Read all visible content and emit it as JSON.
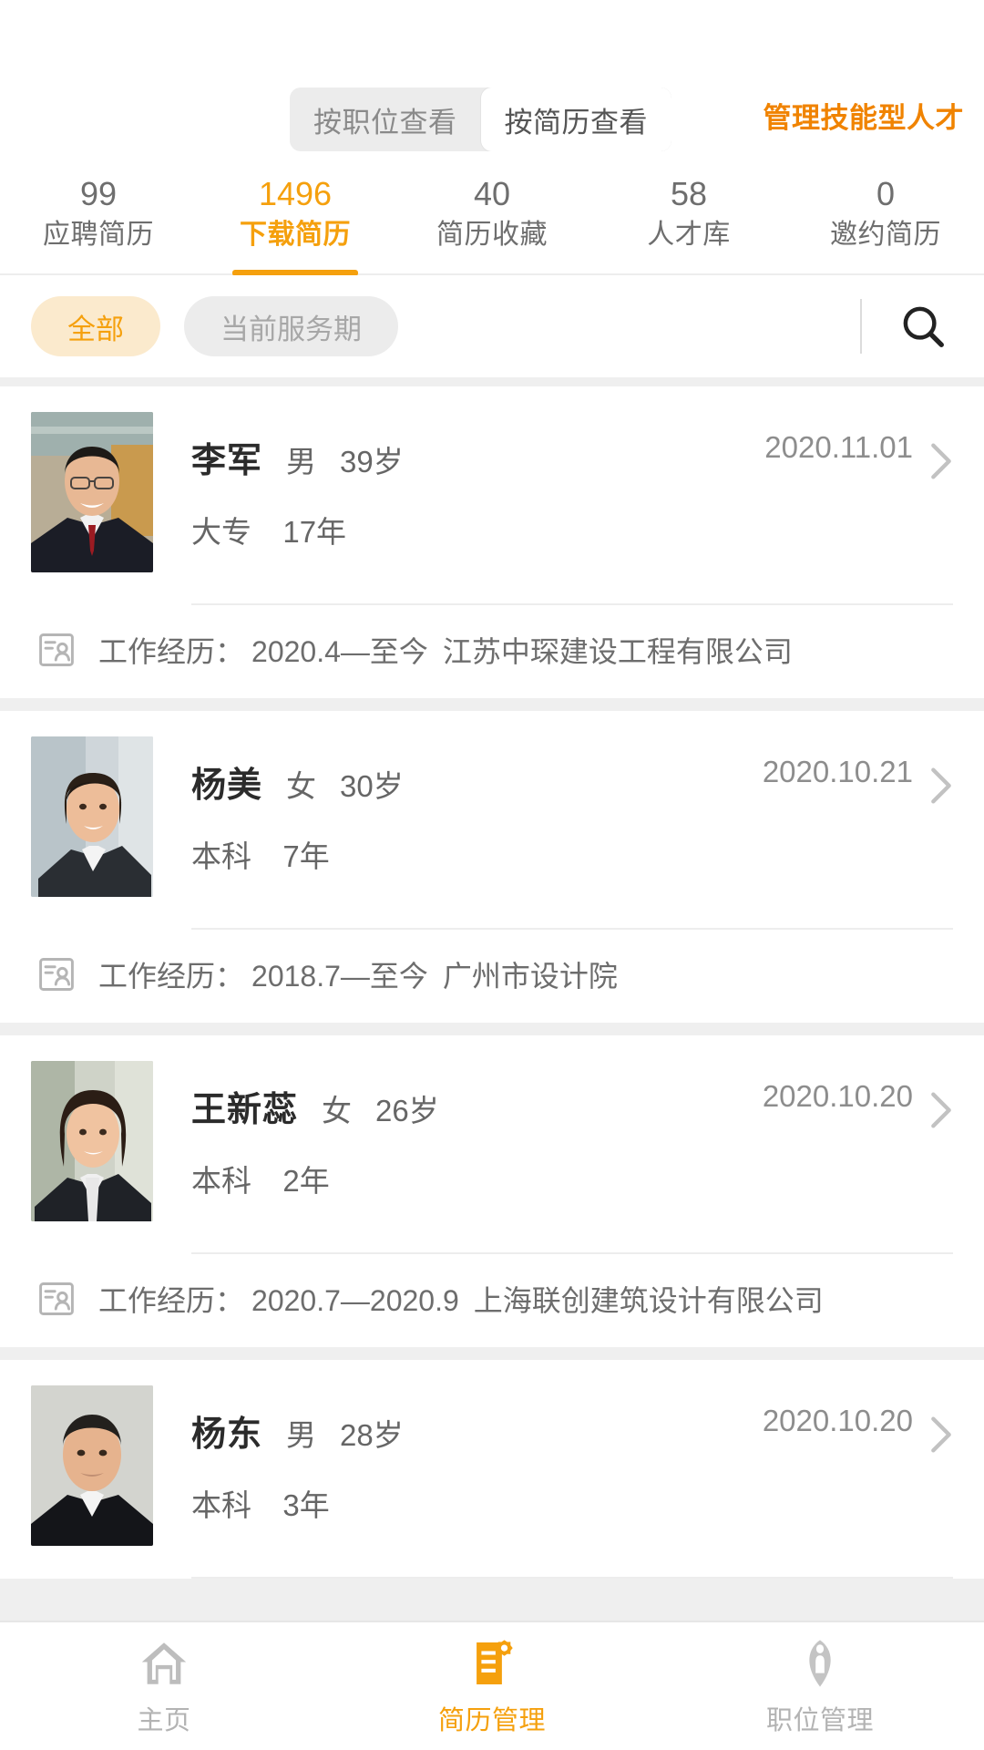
{
  "header": {
    "segmented": {
      "options": [
        {
          "label": "按职位查看",
          "active": false
        },
        {
          "label": "按简历查看",
          "active": true
        }
      ]
    },
    "action_label": "管理技能型人才"
  },
  "stats": [
    {
      "count": "99",
      "label": "应聘简历",
      "active": false
    },
    {
      "count": "1496",
      "label": "下载简历",
      "active": true
    },
    {
      "count": "40",
      "label": "简历收藏",
      "active": false
    },
    {
      "count": "58",
      "label": "人才库",
      "active": false
    },
    {
      "count": "0",
      "label": "邀约简历",
      "active": false
    }
  ],
  "filter": {
    "chips": [
      {
        "label": "全部",
        "active": true
      },
      {
        "label": "当前服务期",
        "active": false
      }
    ],
    "search_icon": "search-icon"
  },
  "resumes": [
    {
      "name": "李军",
      "gender": "男",
      "age": "39岁",
      "education": "大专",
      "experience_years": "17年",
      "date": "2020.11.01",
      "work_label": "工作经历：",
      "work_period": "2020.4—至今",
      "work_company": "江苏中琛建设工程有限公司",
      "avatar": "male-1"
    },
    {
      "name": "杨美",
      "gender": "女",
      "age": "30岁",
      "education": "本科",
      "experience_years": "7年",
      "date": "2020.10.21",
      "work_label": "工作经历：",
      "work_period": "2018.7—至今",
      "work_company": "广州市设计院",
      "avatar": "female-1"
    },
    {
      "name": "王新蕊",
      "gender": "女",
      "age": "26岁",
      "education": "本科",
      "experience_years": "2年",
      "date": "2020.10.20",
      "work_label": "工作经历：",
      "work_period": "2020.7—2020.9",
      "work_company": "上海联创建筑设计有限公司",
      "avatar": "female-2"
    },
    {
      "name": "杨东",
      "gender": "男",
      "age": "28岁",
      "education": "本科",
      "experience_years": "3年",
      "date": "2020.10.20",
      "work_label": "",
      "work_period": "",
      "work_company": "",
      "avatar": "male-2"
    }
  ],
  "tabbar": [
    {
      "label": "主页",
      "icon": "home-icon",
      "active": false
    },
    {
      "label": "简历管理",
      "icon": "resume-icon",
      "active": true
    },
    {
      "label": "职位管理",
      "icon": "job-icon",
      "active": false
    }
  ],
  "colors": {
    "accent": "#f5a00d",
    "accent_text": "#f08300",
    "chip_on_bg": "#fbeacd",
    "muted": "#8a8a8a",
    "page_bg": "#efefef"
  }
}
